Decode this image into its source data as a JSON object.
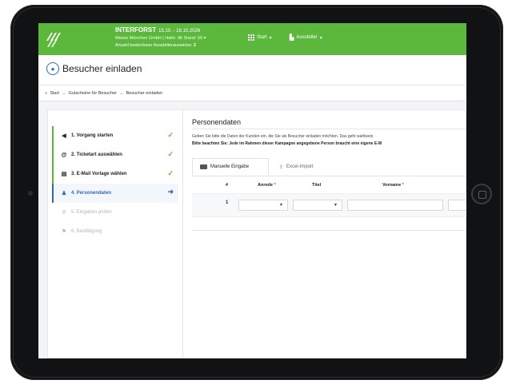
{
  "header": {
    "fair_name": "INTERFORST",
    "fair_dates": "15.10. - 18.10.2026",
    "company_line": "Messe München GmbH | Halle: d6 Stand: 50",
    "quota_label": "Anzahl kostenloser Ausstellerausweise:",
    "quota_value": "2",
    "nav_start": "Start",
    "nav_aussteller": "Aussteller"
  },
  "page": {
    "title": "Besucher einladen"
  },
  "breadcrumb": {
    "items": [
      "Start",
      "Gutscheine für Besucher",
      "Besucher einladen"
    ],
    "separator": "→"
  },
  "steps": [
    {
      "label": "1. Vorgang starten",
      "status": "done",
      "icon": "megaphone-icon"
    },
    {
      "label": "2. Ticketart auswählen",
      "status": "done",
      "icon": "at-icon"
    },
    {
      "label": "3. E-Mail Vorlage wählen",
      "status": "done",
      "icon": "template-icon"
    },
    {
      "label": "4. Personendaten",
      "status": "active",
      "icon": "person-icon"
    },
    {
      "label": "5. Eingaben prüfen",
      "status": "pending",
      "icon": "magnifier-icon"
    },
    {
      "label": "6. Bestätigung",
      "status": "pending",
      "icon": "flag-icon"
    }
  ],
  "section": {
    "title": "Personendaten",
    "description": "Geben Sie bitte die Daten der Kunden ein, die Sie als Besucher einladen möchten. Das geht wahlweis",
    "notice": "Bitte beachten Sie: Jede im Rahmen dieser Kampagne angegebene Person braucht eine eigene E-M"
  },
  "tabs": [
    {
      "label": "Manuelle Eingabe",
      "active": true
    },
    {
      "label": "Excel-Import",
      "active": false
    }
  ],
  "table": {
    "headers": {
      "num": "#",
      "anrede": "Anrede",
      "titel": "Titel",
      "vorname": "Vorname"
    },
    "required_marker": "*",
    "rows": [
      {
        "num": "1"
      }
    ]
  },
  "colors": {
    "brand_green": "#5cb83c",
    "accent_blue": "#2d6cb5",
    "required_red": "#e02828"
  }
}
